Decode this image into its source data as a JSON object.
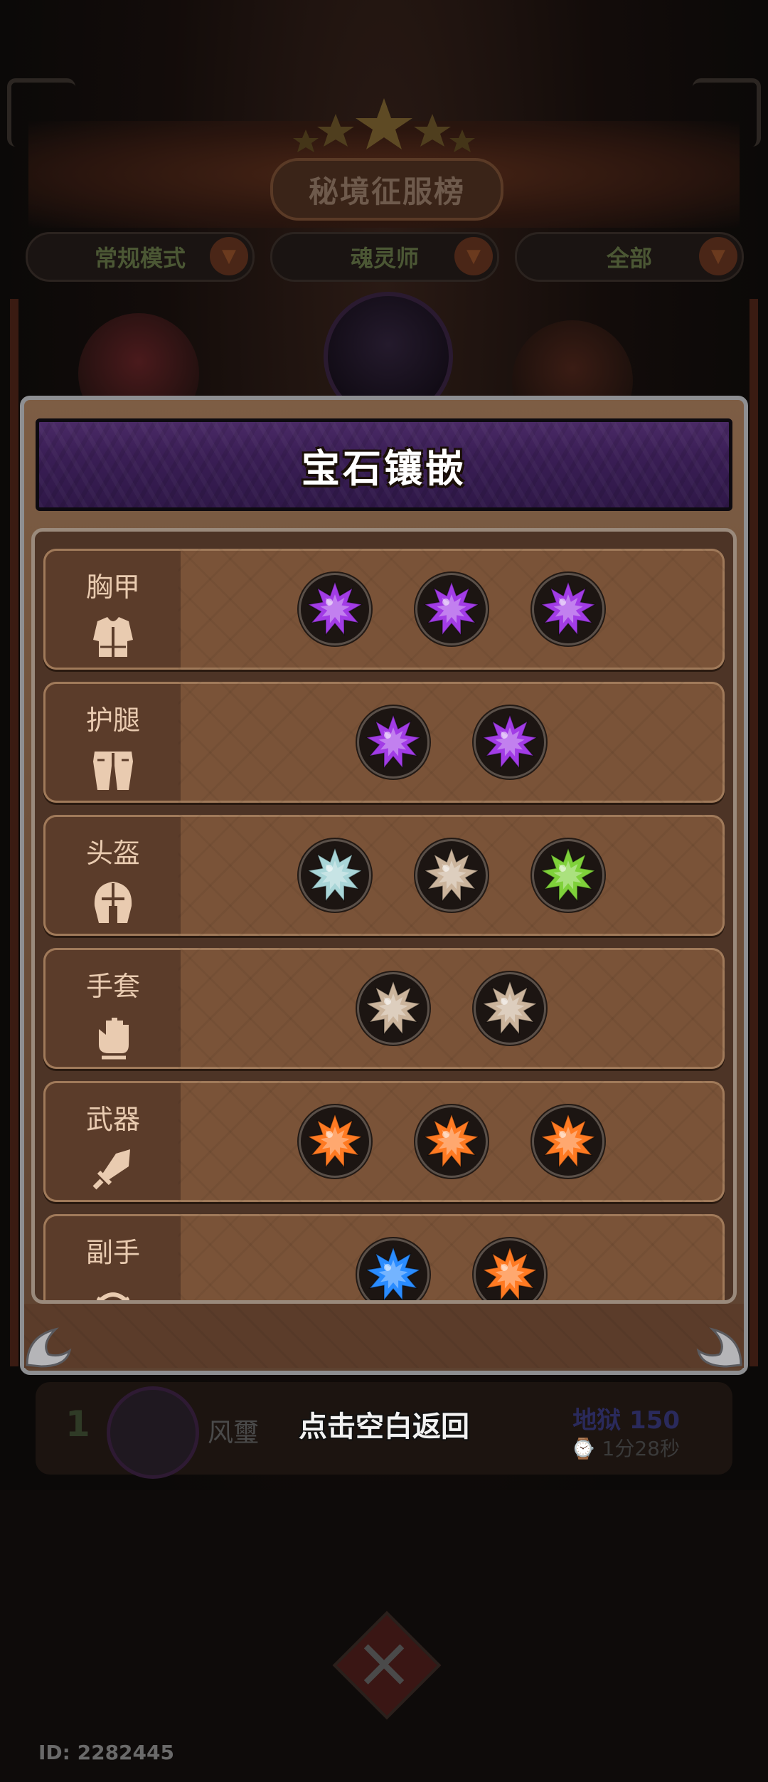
{
  "background": {
    "ranking_title": "秘境征服榜",
    "filters": [
      {
        "label": "常规模式"
      },
      {
        "label": "魂灵师"
      },
      {
        "label": "全部"
      }
    ],
    "top_entry": {
      "rank": "1",
      "name": "风璽",
      "difficulty": "地狱 150",
      "time": "1分28秒"
    }
  },
  "dialog": {
    "title": "宝石镶嵌",
    "slots": [
      {
        "name": "胸甲",
        "icon": "chest-armor-icon",
        "gems": [
          "purple",
          "purple",
          "purple"
        ]
      },
      {
        "name": "护腿",
        "icon": "leg-armor-icon",
        "gems": [
          "purple",
          "purple"
        ]
      },
      {
        "name": "头盔",
        "icon": "helmet-icon",
        "gems": [
          "cyan",
          "beige",
          "green"
        ]
      },
      {
        "name": "手套",
        "icon": "glove-icon",
        "gems": [
          "beige",
          "beige"
        ]
      },
      {
        "name": "武器",
        "icon": "sword-icon",
        "gems": [
          "orange",
          "orange",
          "orange"
        ]
      },
      {
        "name": "副手",
        "icon": "offhand-bow-icon",
        "gems": [
          "blue",
          "orange"
        ]
      }
    ]
  },
  "hint": "点击空白返回",
  "user_id": "ID: 2282445",
  "gem_colors": {
    "purple": "#a23ce6",
    "cyan": "#a9d6d8",
    "beige": "#cbb49c",
    "green": "#7fd13a",
    "orange": "#ff7a22",
    "blue": "#2a8cff"
  }
}
